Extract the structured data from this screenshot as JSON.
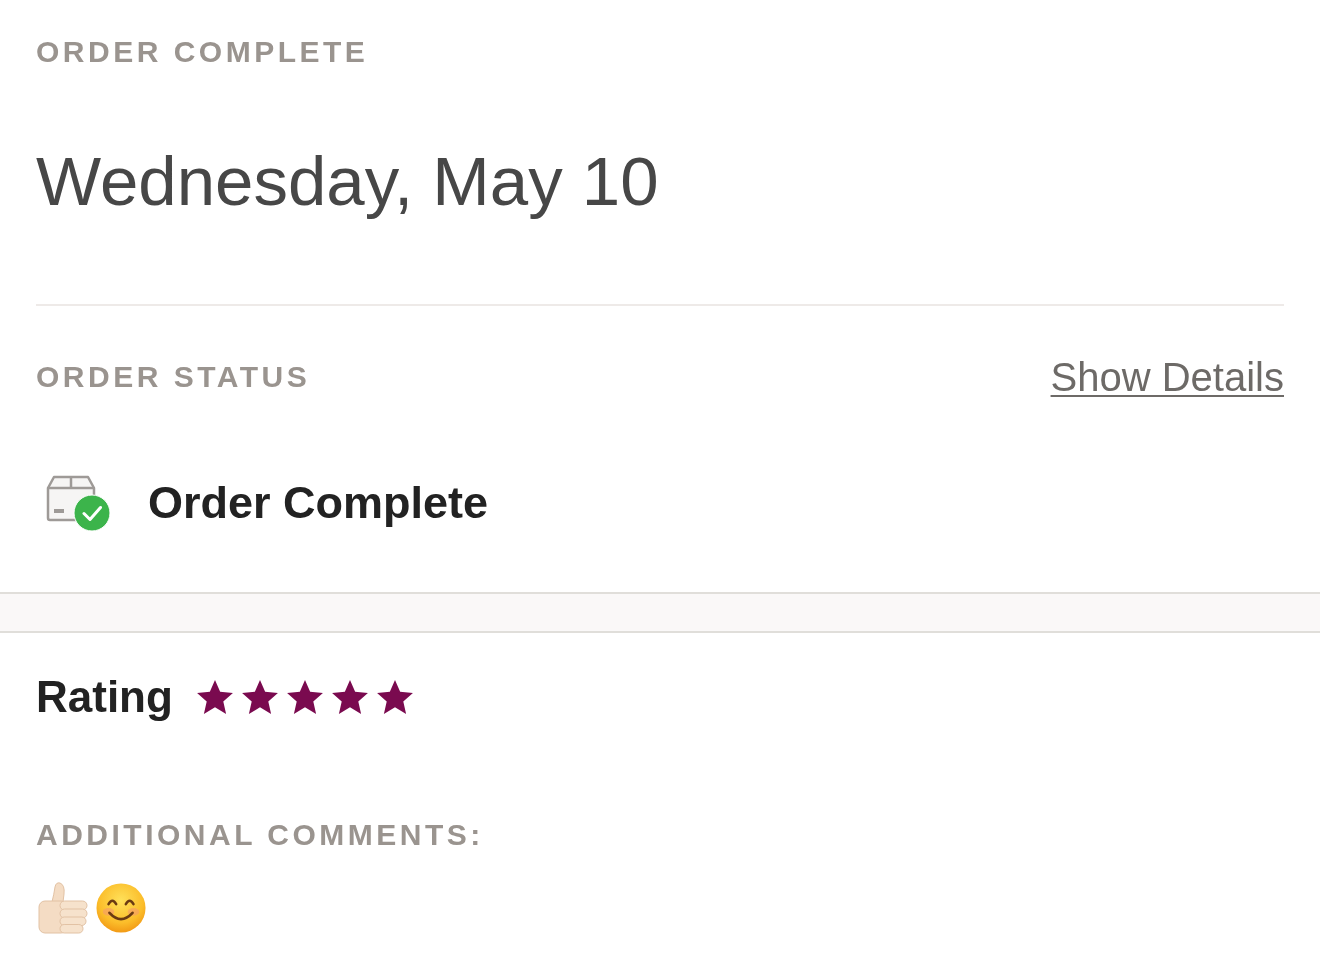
{
  "header": {
    "label": "ORDER COMPLETE",
    "date": "Wednesday, May 10"
  },
  "order_status": {
    "label": "ORDER STATUS",
    "link": "Show Details",
    "status": "Order Complete"
  },
  "rating": {
    "label": "Rating",
    "stars": 5
  },
  "comments": {
    "label": "ADDITIONAL COMMENTS:",
    "emojis": [
      {
        "kind": "thumbs_up"
      },
      {
        "kind": "smile"
      }
    ]
  }
}
